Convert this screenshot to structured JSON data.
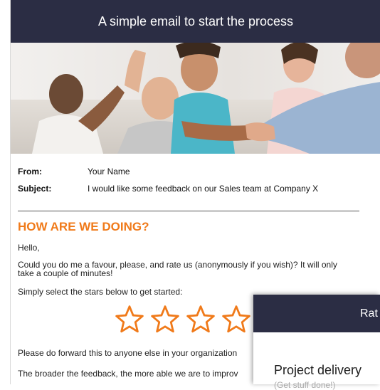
{
  "header": {
    "title": "A simple email to start the process"
  },
  "email": {
    "from_label": "From:",
    "from_value": "Your Name",
    "subject_label": "Subject:",
    "subject_value": "I would like some feedback on our Sales team at Company X"
  },
  "body": {
    "heading": "HOW ARE WE DOING?",
    "greeting": "Hello,",
    "paragraph1_line1": "Could you do me a favour, please, and rate us (anonymously if you wish)? It will only",
    "paragraph1_line2": "take a couple of minutes!",
    "instruction": "Simply select the stars below to get started:",
    "forward_text": "Please do forward this to anyone else in your organization",
    "broader_text": "The broader the feedback, the more able we are to improv"
  },
  "stars": {
    "count_visible": 4,
    "color": "#f07a1a"
  },
  "popup": {
    "header_text": "Rat",
    "item_title": "Project delivery",
    "item_subtitle": "(Get stuff done!)"
  },
  "colors": {
    "header_bg": "#2b2d44",
    "accent": "#f07a1a"
  }
}
